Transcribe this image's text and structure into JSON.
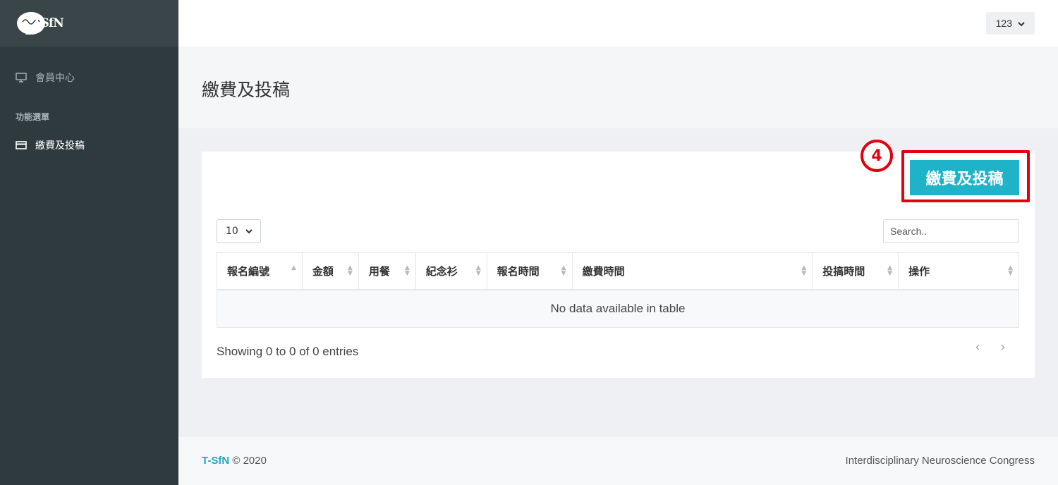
{
  "sidebar": {
    "logo_text": "TSfN",
    "member_center": "會員中心",
    "section_label": "功能選單",
    "pay_item": "繳費及投稿"
  },
  "topbar": {
    "user_label": "123"
  },
  "page": {
    "title": "繳費及投稿"
  },
  "card": {
    "pay_button": "繳費及投稿",
    "step_number": "4",
    "page_size": "10",
    "search_placeholder": "Search..",
    "columns": [
      "報名編號",
      "金額",
      "用餐",
      "紀念衫",
      "報名時間",
      "繳費時間",
      "投搞時間",
      "操作"
    ],
    "empty_message": "No data available in table",
    "info": "Showing 0 to 0 of 0 entries"
  },
  "footer": {
    "brand": "T-SfN",
    "copyright": "© 2020",
    "right_text": "Interdisciplinary Neuroscience Congress"
  },
  "colors": {
    "accent": "#1fb3c9",
    "highlight": "#e3000f",
    "sidebar": "#2f3a3f"
  },
  "icons": {
    "member": "monitor-icon",
    "pay": "credit-card-icon",
    "user_menu": "chevron-down-icon"
  }
}
